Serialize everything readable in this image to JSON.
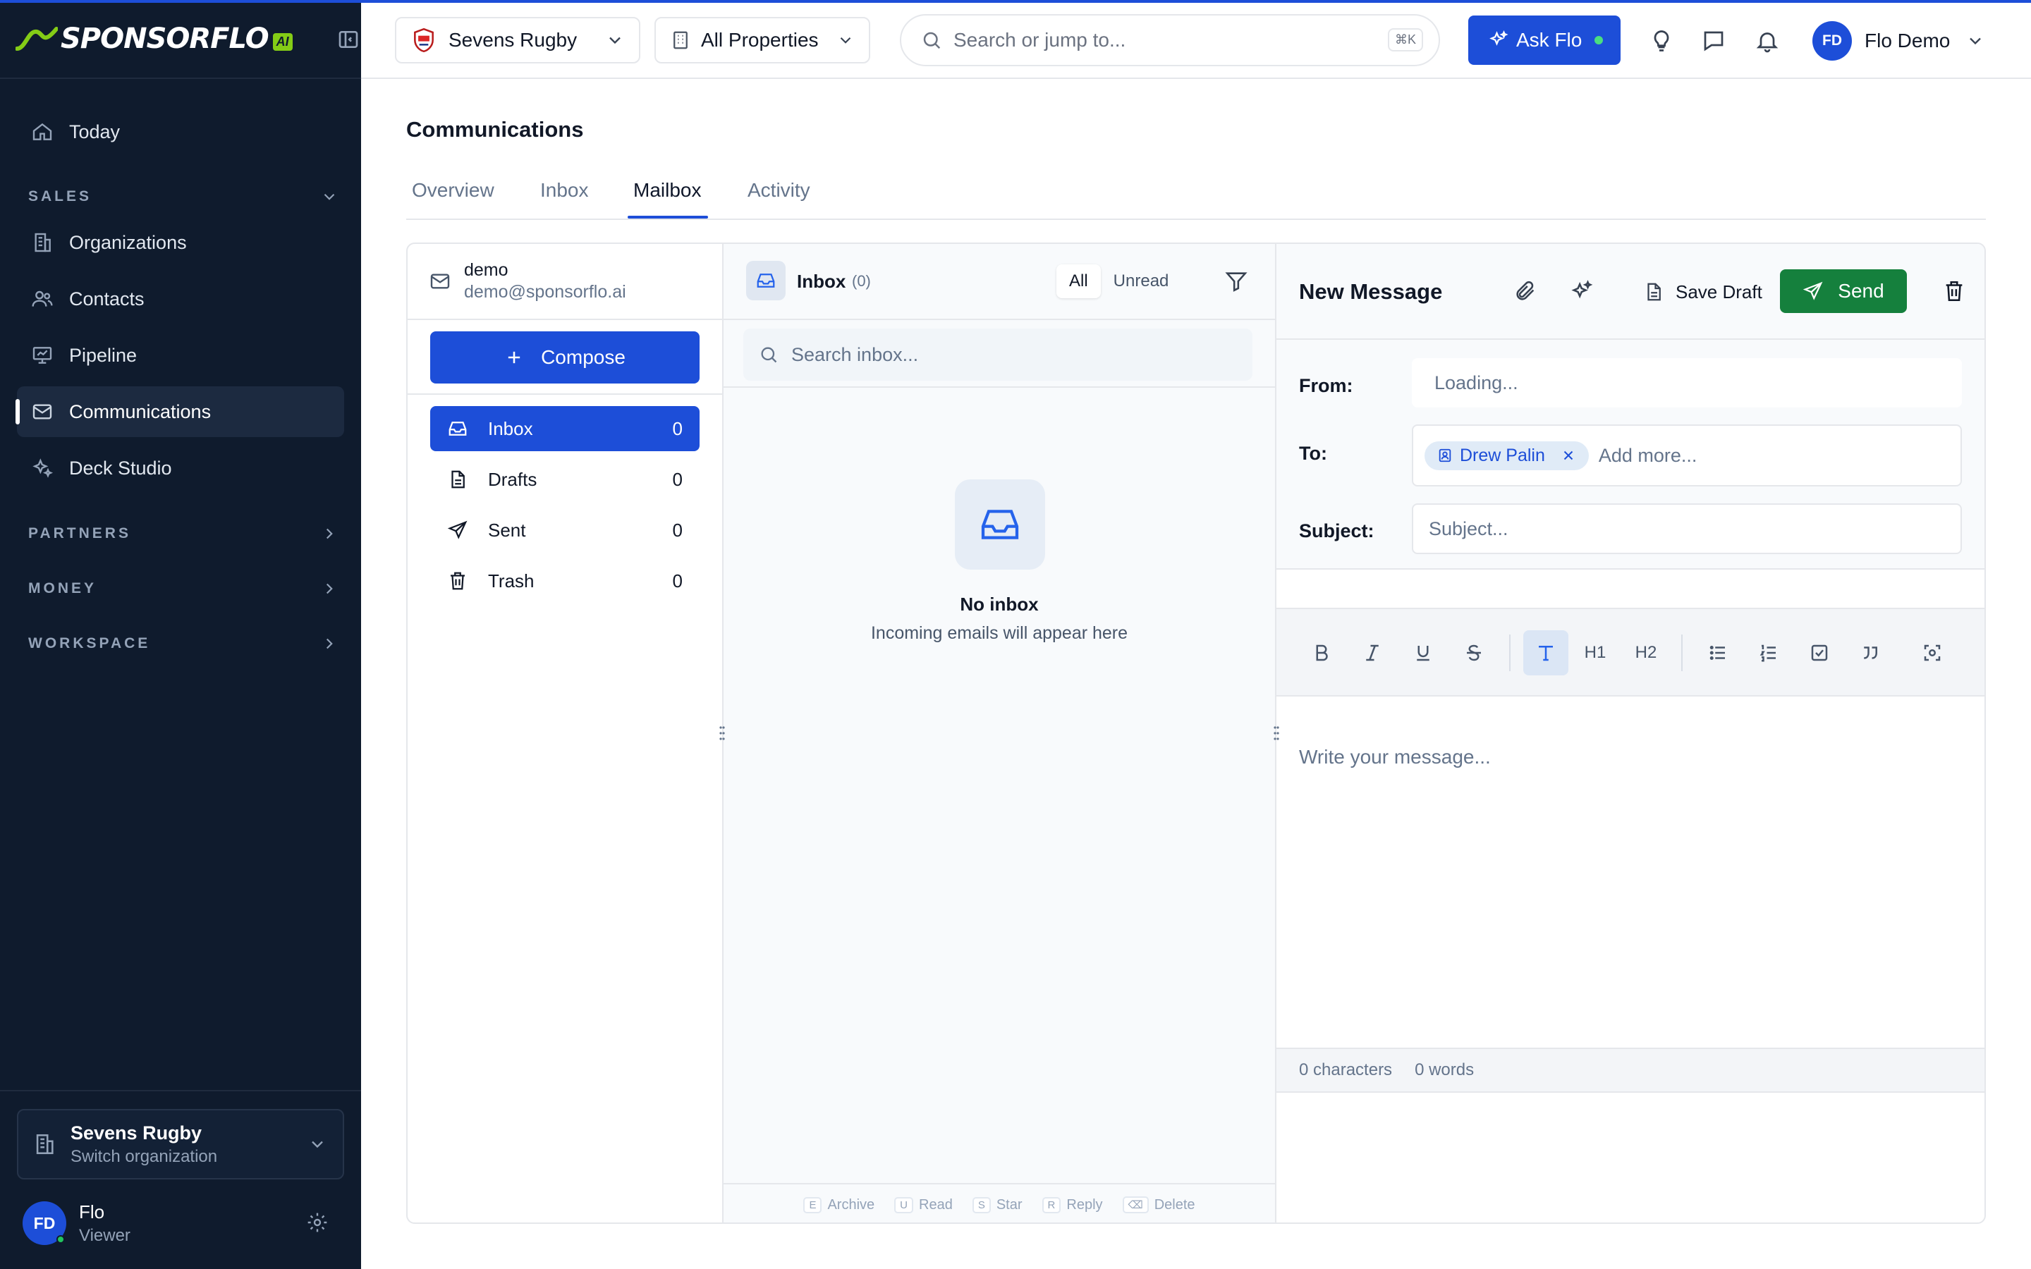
{
  "brand": {
    "name": "SPONSORFLO",
    "badge": "AI",
    "accent": "#84cc16",
    "primary": "#1d4ed8"
  },
  "sidebar": {
    "items": [
      {
        "label": "Today",
        "icon": "home-icon"
      },
      {
        "label": "Organizations",
        "icon": "building-icon"
      },
      {
        "label": "Contacts",
        "icon": "users-icon"
      },
      {
        "label": "Pipeline",
        "icon": "presentation-icon"
      },
      {
        "label": "Communications",
        "icon": "mail-icon"
      },
      {
        "label": "Deck Studio",
        "icon": "sparkles-icon"
      }
    ],
    "sections": {
      "sales": "SALES",
      "partners": "PARTNERS",
      "money": "MONEY",
      "workspace": "WORKSPACE"
    },
    "org": {
      "name": "Sevens Rugby",
      "sub": "Switch organization"
    },
    "user": {
      "initials": "FD",
      "name": "Flo",
      "role": "Viewer"
    }
  },
  "header": {
    "org_select": "Sevens Rugby",
    "property_select": "All Properties",
    "search_placeholder": "Search or jump to...",
    "search_shortcut": "⌘K",
    "ask_label": "Ask Flo",
    "user_initials": "FD",
    "user_name": "Flo Demo"
  },
  "page": {
    "title": "Communications",
    "tabs": [
      "Overview",
      "Inbox",
      "Mailbox",
      "Activity"
    ]
  },
  "mailbox": {
    "account_name": "demo",
    "account_email": "demo@sponsorflo.ai",
    "compose_label": "Compose",
    "folders": [
      {
        "label": "Inbox",
        "count": "0"
      },
      {
        "label": "Drafts",
        "count": "0"
      },
      {
        "label": "Sent",
        "count": "0"
      },
      {
        "label": "Trash",
        "count": "0"
      }
    ]
  },
  "inbox": {
    "title": "Inbox",
    "count": "(0)",
    "filter_all": "All",
    "filter_unread": "Unread",
    "search_placeholder": "Search inbox...",
    "empty_title": "No inbox",
    "empty_sub": "Incoming emails will appear here",
    "shortcuts": [
      {
        "key": "E",
        "label": "Archive"
      },
      {
        "key": "U",
        "label": "Read"
      },
      {
        "key": "S",
        "label": "Star"
      },
      {
        "key": "R",
        "label": "Reply"
      },
      {
        "key": "⌫",
        "label": "Delete"
      }
    ]
  },
  "composer": {
    "title": "New Message",
    "save_draft": "Save Draft",
    "send": "Send",
    "from_label": "From:",
    "from_value": "Loading...",
    "to_label": "To:",
    "recipient": "Drew Palin",
    "to_placeholder": "Add more...",
    "subject_label": "Subject:",
    "subject_placeholder": "Subject...",
    "body_placeholder": "Write your message...",
    "toolbar": {
      "h1": "H1",
      "h2": "H2"
    },
    "characters": "0 characters",
    "words": "0 words"
  }
}
